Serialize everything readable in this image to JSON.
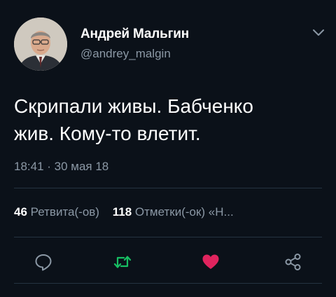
{
  "author": {
    "name": "Андрей Мальгин",
    "handle": "@andrey_malgin"
  },
  "tweet": {
    "line1": "Скрипали живы. Бабченко",
    "line2": "жив. Кому-то влетит.",
    "timestamp": "18:41 · 30 мая 18"
  },
  "stats": {
    "retweets_count": "46",
    "retweets_label": "Ретвита(-ов)",
    "likes_count": "118",
    "likes_label": "Отметки(-ок) «Н..."
  },
  "actions": {
    "reply_icon": "reply-icon",
    "retweet_icon": "retweet-icon",
    "like_icon": "heart-icon",
    "share_icon": "share-icon"
  },
  "colors": {
    "background": "#0b1119",
    "muted": "#8b98a5",
    "retweet_green": "#17bf63",
    "like_red": "#e0245e",
    "divider": "#253341"
  }
}
